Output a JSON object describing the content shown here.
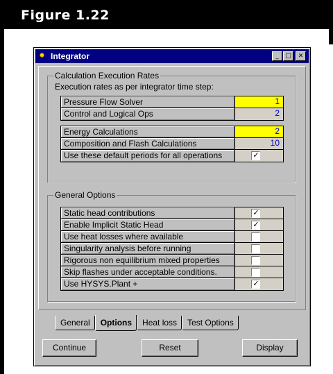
{
  "figure": {
    "title": "Figure 1.22"
  },
  "window": {
    "title": "Integrator",
    "controls": {
      "minimize": "_",
      "maximize": "□",
      "close": "✕"
    }
  },
  "rates": {
    "legend": "Calculation Execution Rates",
    "subtitle": "Execution rates as per integrator time step:",
    "block1": [
      {
        "label": "Pressure Flow Solver",
        "value": "1",
        "highlight": true
      },
      {
        "label": "Control and Logical Ops",
        "value": "2",
        "highlight": false
      }
    ],
    "block2": [
      {
        "label": "Energy Calculations",
        "value": "2",
        "highlight": true
      },
      {
        "label": "Composition and Flash Calculations",
        "value": "10",
        "highlight": false
      }
    ],
    "default_periods": {
      "label": "Use these default periods for all operations",
      "checked": true,
      "mark": "✓"
    }
  },
  "general": {
    "legend": "General Options",
    "options": [
      {
        "label": "Static head contributions",
        "checked": true,
        "mark": "✓"
      },
      {
        "label": "Enable Implicit Static Head",
        "checked": true,
        "mark": "✓"
      },
      {
        "label": "Use heat losses where available",
        "checked": false,
        "mark": ""
      },
      {
        "label": "Singularity analysis before running",
        "checked": false,
        "mark": ""
      },
      {
        "label": "Rigorous non equilibrium mixed properties",
        "checked": false,
        "mark": ""
      },
      {
        "label": "Skip flashes under acceptable conditions.",
        "checked": false,
        "mark": ""
      },
      {
        "label": "Use HYSYS.Plant +",
        "checked": true,
        "mark": "✓"
      }
    ]
  },
  "tabs": [
    {
      "label": "General",
      "active": false
    },
    {
      "label": "Options",
      "active": true
    },
    {
      "label": "Heat loss",
      "active": false
    },
    {
      "label": "Test Options",
      "active": false
    }
  ],
  "buttons": {
    "continue": "Continue",
    "reset": "Reset",
    "display": "Display"
  },
  "colors": {
    "title_bar": "#000080",
    "highlight": "#ffff00",
    "value_text": "#0000c0",
    "window_bg": "#c0c0c0"
  }
}
